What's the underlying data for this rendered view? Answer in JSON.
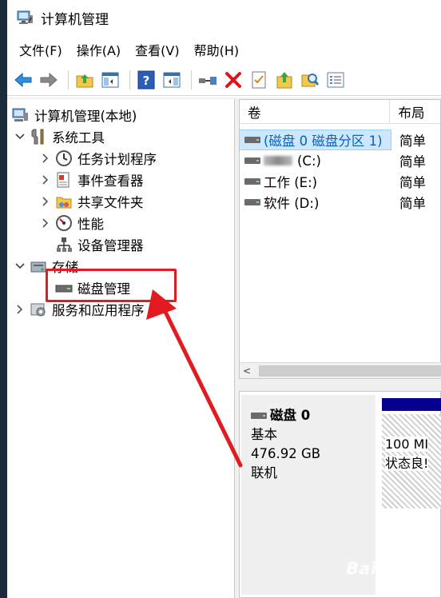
{
  "window": {
    "title": "计算机管理"
  },
  "menu": [
    "文件(F)",
    "操作(A)",
    "查看(V)",
    "帮助(H)"
  ],
  "toolbar": [
    "back-icon",
    "forward-icon",
    "up-folder-icon",
    "show-hide-tree-icon",
    "help-icon",
    "show-action-pane-icon",
    "connect-icon",
    "delete-icon",
    "properties-icon",
    "import-icon",
    "search-icon",
    "checklist-icon"
  ],
  "tree": {
    "root": "计算机管理(本地)",
    "system_tools": "系统工具",
    "task_scheduler": "任务计划程序",
    "event_viewer": "事件查看器",
    "shared_folders": "共享文件夹",
    "performance": "性能",
    "device_manager": "设备管理器",
    "storage": "存储",
    "disk_management": "磁盘管理",
    "services": "服务和应用程序"
  },
  "volumes": {
    "headers": [
      "卷",
      "布局"
    ],
    "rows": [
      {
        "name": "(磁盘 0 磁盘分区 1)",
        "layout": "简单"
      },
      {
        "name": "(C:)",
        "layout": "简单"
      },
      {
        "name": "工作 (E:)",
        "layout": "简单"
      },
      {
        "name": "软件 (D:)",
        "layout": "简单"
      }
    ]
  },
  "disk": {
    "name": "磁盘 0",
    "type": "基本",
    "size": "476.92 GB",
    "status": "联机",
    "partition_size": "100 MI",
    "partition_status": "状态良!"
  },
  "watermark": "Bai 经验",
  "colors": {
    "highlight": "#e21b23",
    "partition_bar": "#05008f",
    "selection": "#cce8ff"
  }
}
